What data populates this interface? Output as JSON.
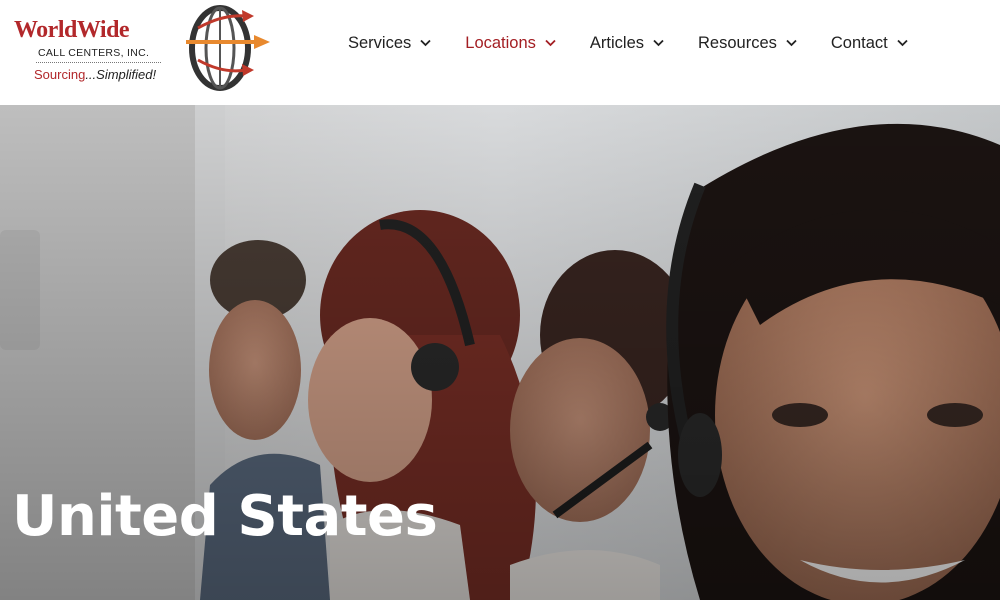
{
  "logo": {
    "wordmark": "WorldWide",
    "subtitle": "CALL CENTERS, INC.",
    "tagline_first": "Sourcing",
    "tagline_rest": "...Simplified!"
  },
  "nav": {
    "items": [
      {
        "label": "Services",
        "active": false
      },
      {
        "label": "Locations",
        "active": true
      },
      {
        "label": "Articles",
        "active": false
      },
      {
        "label": "Resources",
        "active": false
      },
      {
        "label": "Contact",
        "active": false
      }
    ]
  },
  "hero": {
    "title": "United States",
    "image": "call-center-agents-with-headsets-photo"
  },
  "colors": {
    "brand_red": "#b2282b",
    "active_nav": "#a31e23",
    "arrow_orange": "#e8892e",
    "text_dark": "#222222"
  }
}
